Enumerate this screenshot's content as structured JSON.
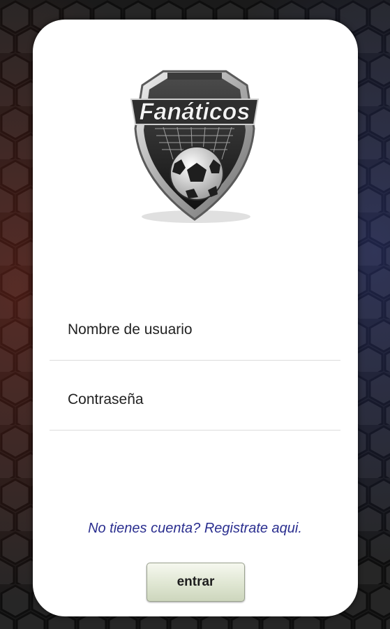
{
  "logo": {
    "text": "Fanáticos"
  },
  "login_form": {
    "username_placeholder": "Nombre de usuario",
    "password_placeholder": "Contraseña",
    "register_link": "No tienes cuenta? Registrate aqui.",
    "submit_label": "entrar"
  },
  "colors": {
    "background": "#1c1c1c",
    "card": "#ffffff",
    "link": "#2a2e8f",
    "button_top": "#f6f8ef",
    "button_bottom": "#cdd6bd"
  }
}
